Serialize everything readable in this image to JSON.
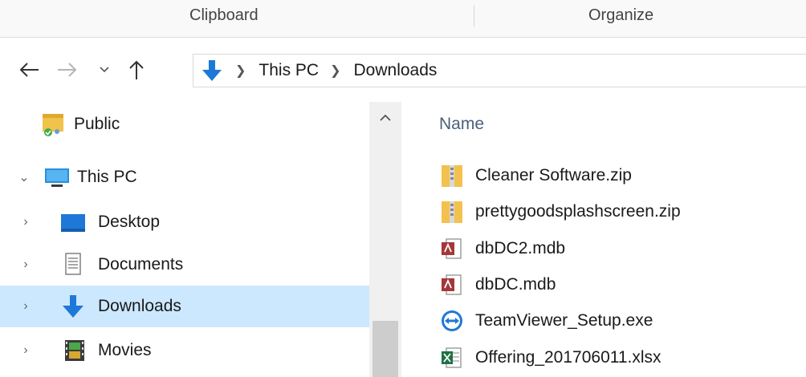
{
  "ribbon": {
    "groups": [
      {
        "label": "Clipboard"
      },
      {
        "label": "Organize"
      }
    ]
  },
  "address_bar": {
    "crumbs": [
      "This PC",
      "Downloads"
    ]
  },
  "nav_pane": {
    "items": [
      {
        "label": "Public",
        "icon": "public-folder-icon",
        "chevron": ""
      },
      {
        "label": "This PC",
        "icon": "this-pc-icon",
        "chevron": "expanded"
      },
      {
        "label": "Desktop",
        "icon": "desktop-icon",
        "chevron": "collapsed"
      },
      {
        "label": "Documents",
        "icon": "documents-icon",
        "chevron": "collapsed"
      },
      {
        "label": "Downloads",
        "icon": "downloads-icon",
        "chevron": "collapsed",
        "selected": true
      },
      {
        "label": "Movies",
        "icon": "movies-icon",
        "chevron": "collapsed"
      }
    ]
  },
  "file_list": {
    "column_header": "Name",
    "files": [
      {
        "name": "Cleaner Software.zip",
        "icon": "zip-folder-icon"
      },
      {
        "name": "prettygoodsplashscreen.zip",
        "icon": "zip-folder-icon"
      },
      {
        "name": "dbDC2.mdb",
        "icon": "access-db-icon"
      },
      {
        "name": "dbDC.mdb",
        "icon": "access-db-icon"
      },
      {
        "name": "TeamViewer_Setup.exe",
        "icon": "teamviewer-icon"
      },
      {
        "name": "Offering_201706011.xlsx",
        "icon": "excel-file-icon"
      }
    ]
  },
  "colors": {
    "selection": "#cce8ff",
    "accent_blue": "#1e78d7",
    "column_header": "#4c607a"
  }
}
